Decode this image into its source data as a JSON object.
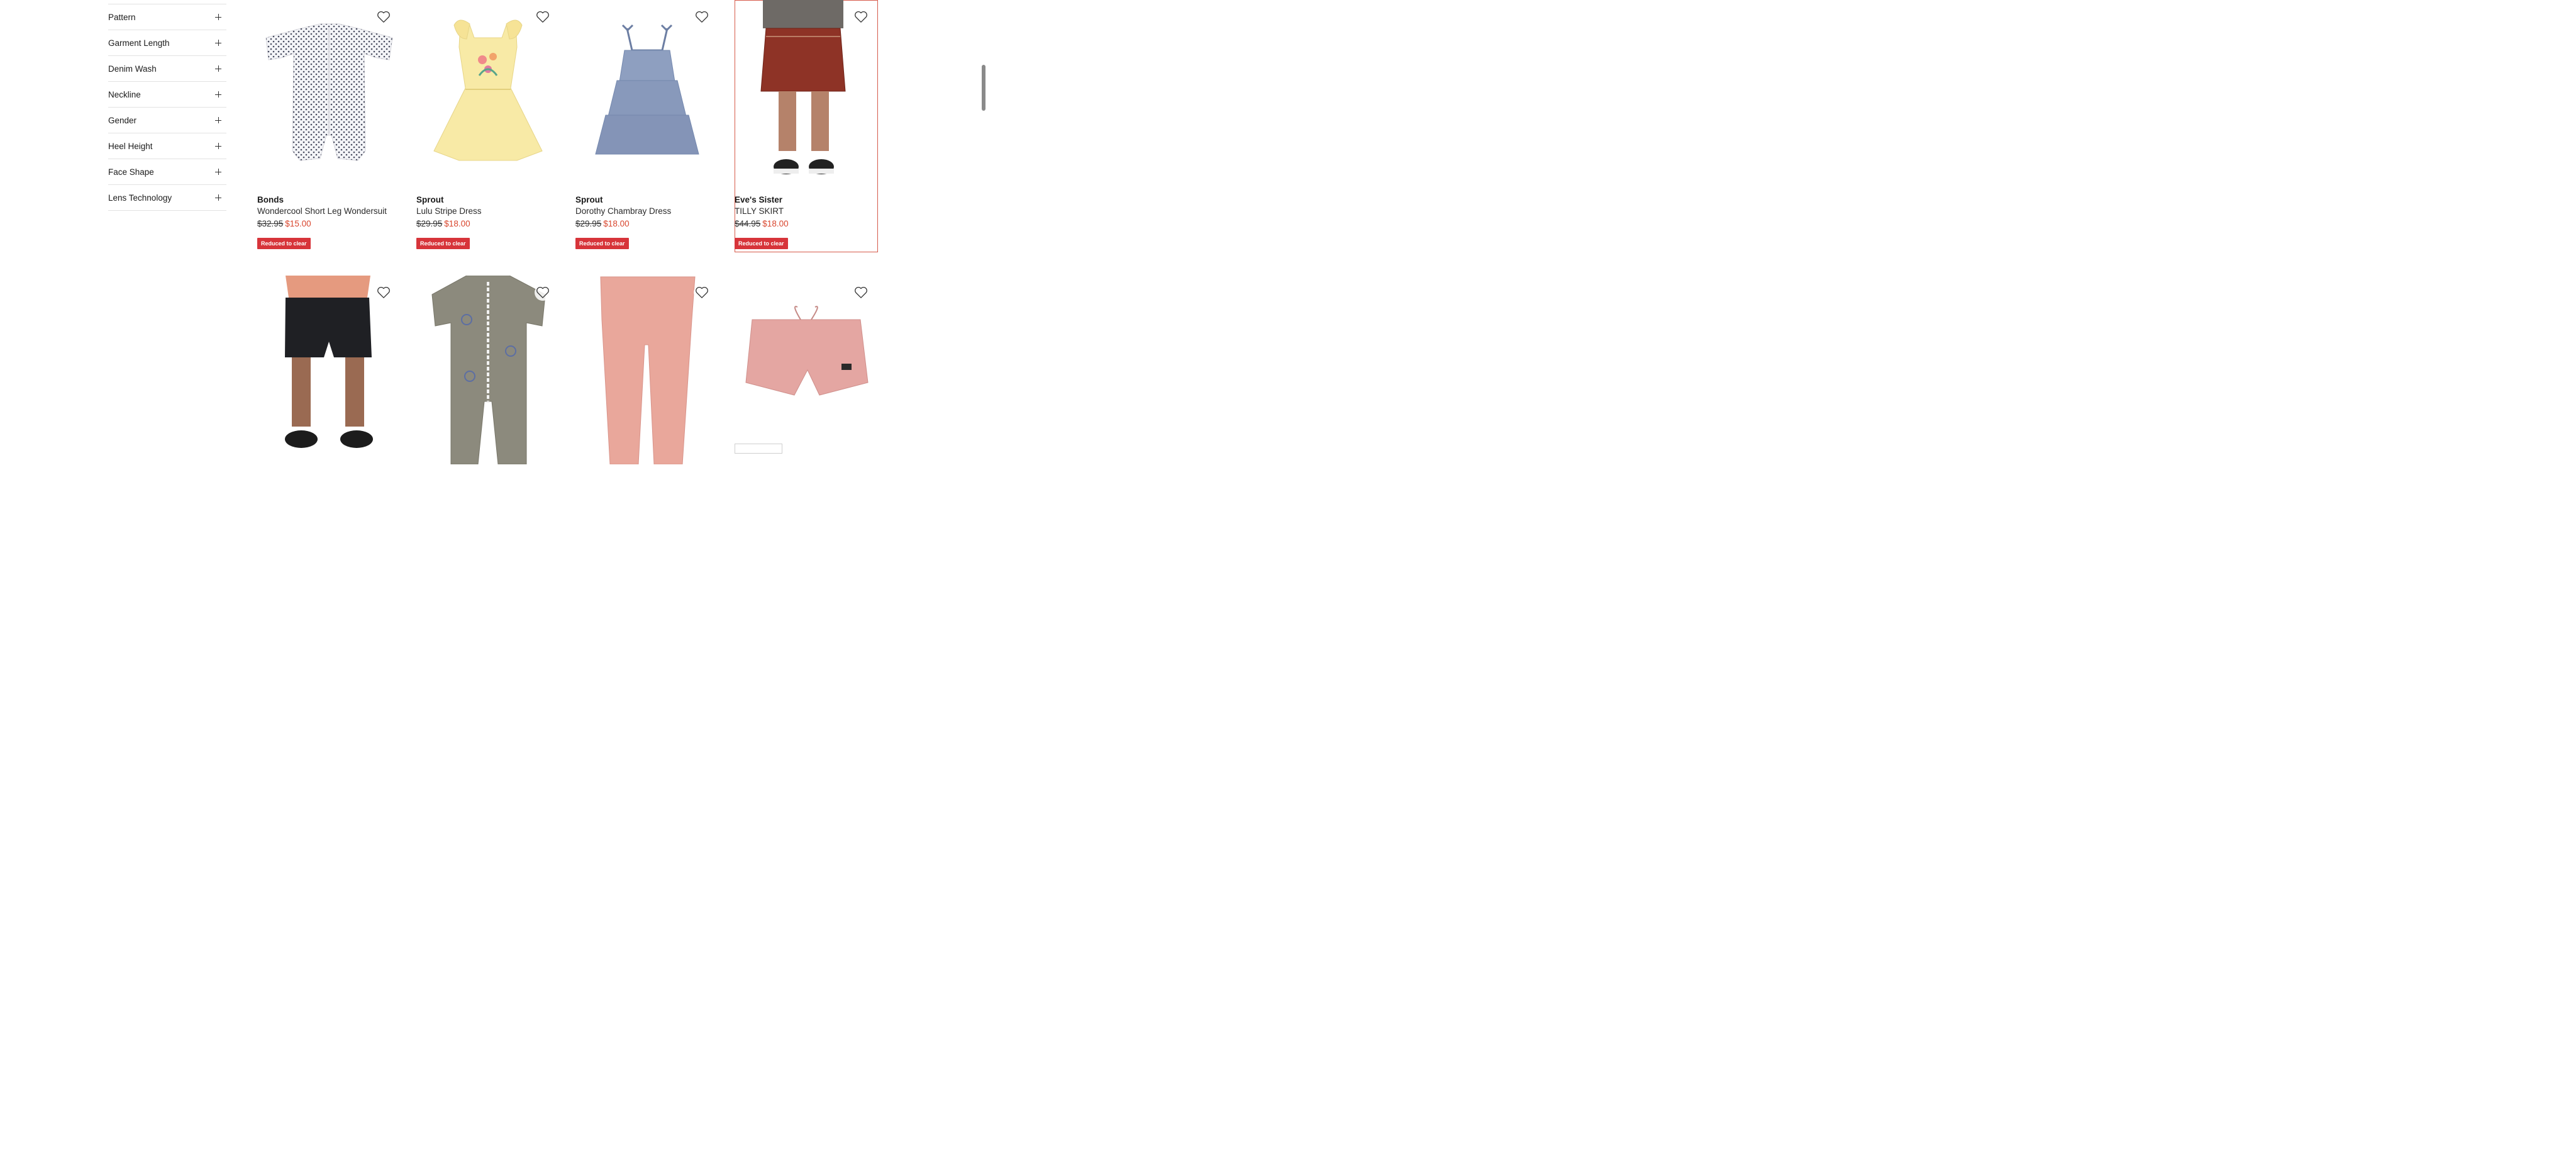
{
  "filters": [
    {
      "label": "Pattern"
    },
    {
      "label": "Garment Length"
    },
    {
      "label": "Denim Wash"
    },
    {
      "label": "Neckline"
    },
    {
      "label": "Gender"
    },
    {
      "label": "Heel Height"
    },
    {
      "label": "Face Shape"
    },
    {
      "label": "Lens Technology"
    }
  ],
  "products": [
    {
      "brand": "Bonds",
      "name": "Wondercool Short Leg Wondersuit",
      "was_price": "$32.95",
      "now_price": "$15.00",
      "badge": "Reduced to clear",
      "image": "white-polka-dot-romper"
    },
    {
      "brand": "Sprout",
      "name": "Lulu Stripe Dress",
      "was_price": "$29.95",
      "now_price": "$18.00",
      "badge": "Reduced to clear",
      "image": "yellow-embroidered-dress"
    },
    {
      "brand": "Sprout",
      "name": "Dorothy Chambray Dress",
      "was_price": "$29.95",
      "now_price": "$18.00",
      "badge": "Reduced to clear",
      "image": "blue-tiered-dress"
    },
    {
      "brand": "Eve's Sister",
      "name": "TILLY SKIRT",
      "was_price": "$44.95",
      "now_price": "$18.00",
      "badge": "Reduced to clear",
      "image": "red-denim-skirt"
    },
    {
      "image": "black-denim-shorts"
    },
    {
      "image": "grey-wondersuit"
    },
    {
      "image": "pink-leggings"
    },
    {
      "image": "pink-shorts"
    }
  ],
  "colors": {
    "accent": "#d7343a",
    "sale_price": "#d9462e",
    "highlight_border": "#d65a4a"
  },
  "icons": {
    "favourite": "heart-outline-icon",
    "expand": "plus-icon"
  }
}
